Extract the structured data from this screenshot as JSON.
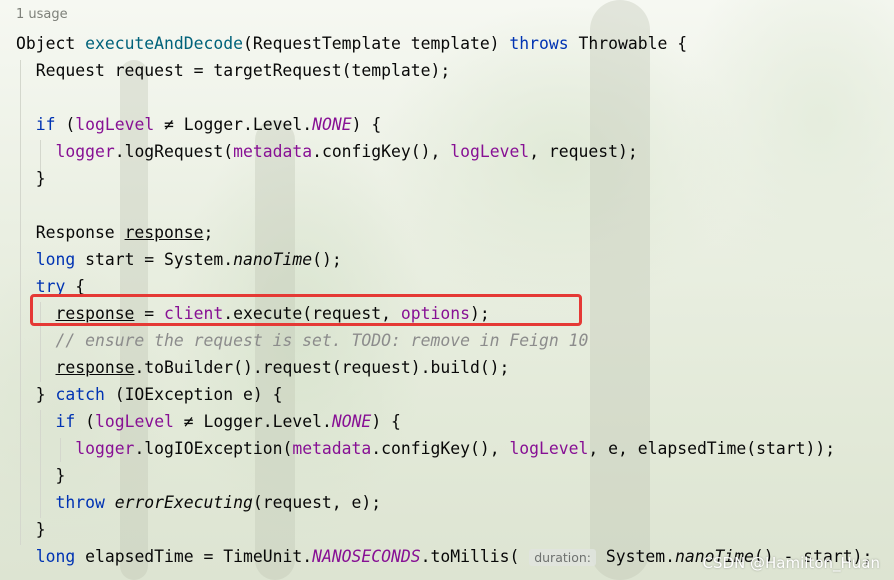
{
  "usage_hint": "1 usage",
  "code": {
    "l1": {
      "type": "Object",
      "method": "executeAndDecode",
      "params": "(RequestTemplate template) ",
      "throws": "throws",
      "rest": " Throwable {"
    },
    "l2": {
      "text": "  Request request = targetRequest(template);"
    },
    "l4": {
      "if": "if",
      "a": " (",
      "logLevel": "logLevel",
      "b": " ≠ Logger.Level.",
      "NONE": "NONE",
      "c": ") {"
    },
    "l5": {
      "logger": "logger",
      "a": ".logRequest(",
      "metadata": "metadata",
      "b": ".configKey(), ",
      "logLevel": "logLevel",
      "c": ", request);"
    },
    "l6": {
      "text": "  }"
    },
    "l8": {
      "a": "  Response ",
      "response": "response",
      "b": ";"
    },
    "l9": {
      "long": "long",
      "a": " start = System.",
      "nano": "nanoTime",
      "b": "();"
    },
    "l10": {
      "try": "try",
      "b": " {"
    },
    "l11": {
      "response": "response",
      "a": " = ",
      "client": "client",
      "b": ".execute(request, ",
      "options": "options",
      "c": ");"
    },
    "l12": {
      "comment": "// ensure the request is set. TODO: remove in Feign 10"
    },
    "l13": {
      "response": "response",
      "a": ".toBuilder().request(request).build();"
    },
    "l14": {
      "a": "  } ",
      "catch": "catch",
      "b": " (IOException e) {"
    },
    "l15": {
      "if": "if",
      "a": " (",
      "logLevel": "logLevel",
      "b": " ≠ Logger.Level.",
      "NONE": "NONE",
      "c": ") {"
    },
    "l16": {
      "logger": "logger",
      "a": ".logIOException(",
      "metadata": "metadata",
      "b": ".configKey(), ",
      "logLevel": "logLevel",
      "c": ", e, elapsedTime(start));"
    },
    "l17": {
      "text": "    }"
    },
    "l18": {
      "throw": "throw",
      "fn": "errorExecuting",
      "a": "(request, e);"
    },
    "l19": {
      "text": "  }"
    },
    "l20": {
      "long": "long",
      "a": " elapsedTime = TimeUnit.",
      "NANO": "NANOSECONDS",
      "b": ".toMillis( ",
      "hint": "duration:",
      "c": " System.",
      "nano": "nanoTime",
      "d": "() - start);"
    }
  },
  "watermark": "CSDN @Hamilton_Huan",
  "colors": {
    "keyword": "#0033b3",
    "method": "#00627a",
    "field": "#871094",
    "comment": "#8c8c8c",
    "highlight_box": "#e53935"
  }
}
